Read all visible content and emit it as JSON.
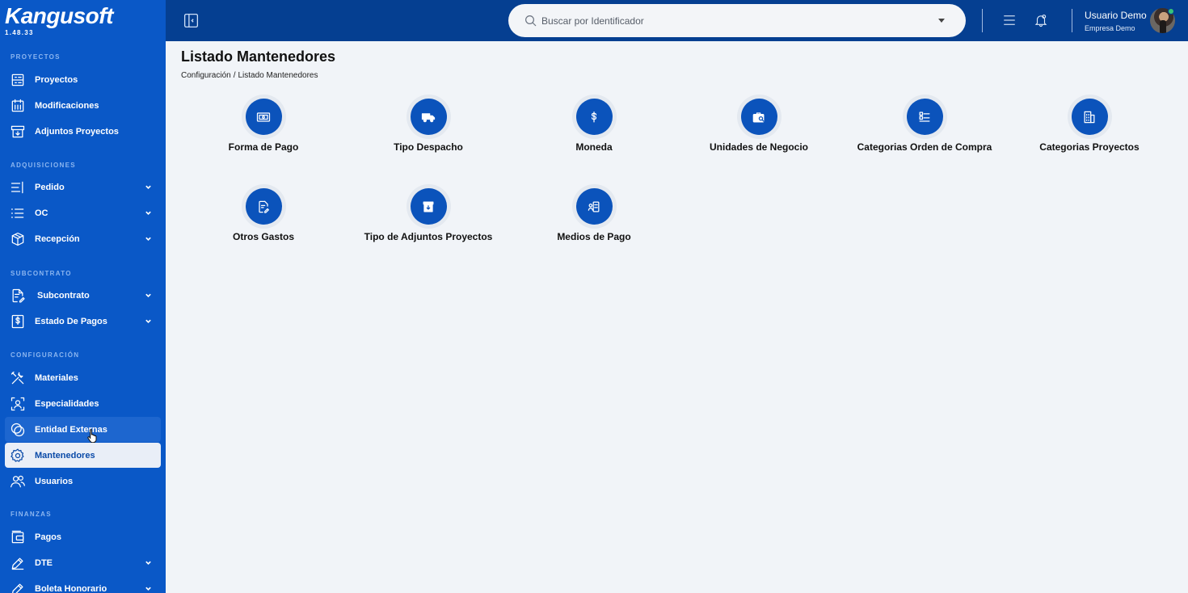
{
  "app": {
    "name": "Kangusoft",
    "version": "1.48.33"
  },
  "sidebar": {
    "sections": [
      {
        "title": "PROYECTOS"
      },
      {
        "title": "ADQUISICIONES"
      },
      {
        "title": "SUBCONTRATO"
      },
      {
        "title": "CONFIGURACIÓN"
      },
      {
        "title": "FINANZAS"
      }
    ],
    "items": [
      {
        "label": "Proyectos",
        "icon": "projects-icon"
      },
      {
        "label": "Modificaciones",
        "icon": "modifications-icon"
      },
      {
        "label": "Adjuntos Proyectos",
        "icon": "attachments-icon"
      },
      {
        "label": "Pedido",
        "icon": "order-icon"
      },
      {
        "label": "OC",
        "icon": "purchase-order-icon"
      },
      {
        "label": "Recepción",
        "icon": "box-icon"
      },
      {
        "label": "Subcontrato",
        "icon": "contract-icon"
      },
      {
        "label": "Estado De Pagos",
        "icon": "dollar-doc-icon"
      },
      {
        "label": "Materiales",
        "icon": "tools-icon"
      },
      {
        "label": "Especialidades",
        "icon": "person-scan-icon"
      },
      {
        "label": "Entidad Externas",
        "icon": "circles-icon"
      },
      {
        "label": "Mantenedores",
        "icon": "gear-icon"
      },
      {
        "label": "Usuarios",
        "icon": "users-icon"
      },
      {
        "label": "Pagos",
        "icon": "wallet-icon"
      },
      {
        "label": "DTE",
        "icon": "pencil-icon"
      },
      {
        "label": "Boleta Honorario",
        "icon": "pencil-icon"
      }
    ]
  },
  "topbar": {
    "search_placeholder": "Buscar por Identificador",
    "user_name": "Usuario Demo",
    "user_company": "Empresa Demo"
  },
  "main": {
    "title": "Listado Mantenedores",
    "breadcrumb": [
      "Configuración",
      "Listado Mantenedores"
    ],
    "breadcrumb_sep": "/",
    "cards": [
      {
        "label": "Forma de Pago",
        "icon": "banknote-icon"
      },
      {
        "label": "Tipo Despacho",
        "icon": "truck-icon"
      },
      {
        "label": "Moneda",
        "icon": "dollar-icon"
      },
      {
        "label": "Unidades de Negocio",
        "icon": "briefcase-search-icon"
      },
      {
        "label": "Categorias Orden de Compra",
        "icon": "list-icon"
      },
      {
        "label": "Categorias Proyectos",
        "icon": "building-icon"
      },
      {
        "label": "Otros Gastos",
        "icon": "document-edit-icon"
      },
      {
        "label": "Tipo de Adjuntos Proyectos",
        "icon": "archive-icon"
      },
      {
        "label": "Medios de Pago",
        "icon": "contact-card-icon"
      }
    ]
  },
  "colors": {
    "sidebar": "#0a58c7",
    "topbar": "#053f91",
    "accent": "#0b53bb",
    "background": "#f1f4f8"
  }
}
